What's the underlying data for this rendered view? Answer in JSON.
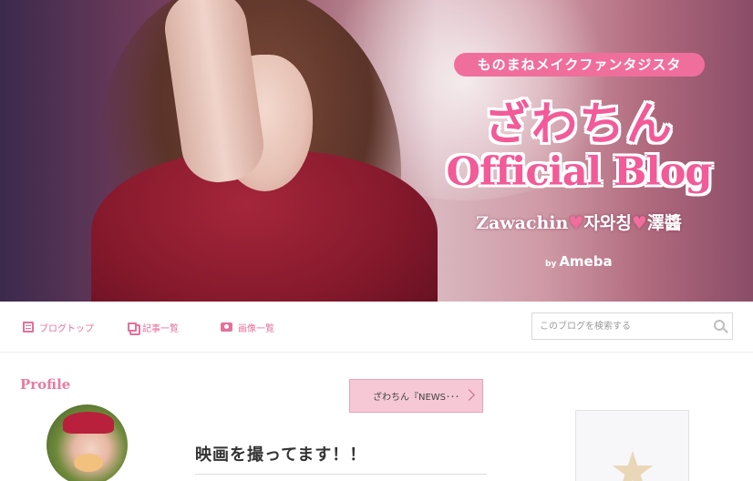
{
  "header": {
    "tagline": "ものまねメイクファンタジスタ",
    "title_jp": "ざわちん",
    "title_en": "Official Blog",
    "subnames": {
      "part1": "Zawachin",
      "heart": "♥",
      "part2": "자와칭",
      "part3": "澤醬"
    },
    "by_prefix": "by",
    "brand": "Ameba"
  },
  "nav": {
    "items": [
      {
        "label": "ブログトップ",
        "icon": "document-icon"
      },
      {
        "label": "記事一覧",
        "icon": "copy-icon"
      },
      {
        "label": "画像一覧",
        "icon": "camera-icon"
      }
    ],
    "search_placeholder": "このブログを検索する",
    "search_icon": "magnifier-icon"
  },
  "sidebar": {
    "profile_heading": "Profile"
  },
  "main": {
    "news_button": "ざわちん『NEWS･･･",
    "entry_title": "映画を撮ってます！！"
  },
  "colors": {
    "accent_pink": "#e5709a",
    "title_pink": "#f25a98",
    "news_bg": "#f6c8d6"
  }
}
